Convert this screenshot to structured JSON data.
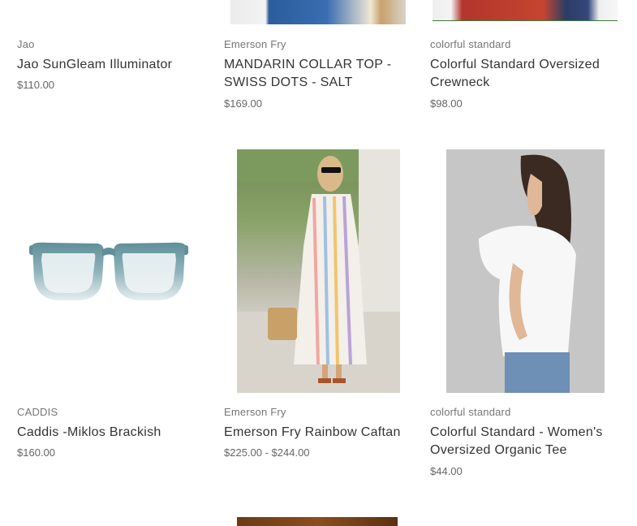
{
  "products": [
    {
      "brand": "Jao",
      "title": "Jao SunGleam Illuminator",
      "price": "$110.00"
    },
    {
      "brand": "Emerson Fry",
      "title_lines": [
        "MANDARIN COLLAR TOP -",
        "SWISS DOTS - SALT"
      ],
      "price": "$169.00"
    },
    {
      "brand": "colorful standard",
      "title_lines": [
        "Colorful Standard Oversized",
        "Crewneck"
      ],
      "price": "$98.00"
    },
    {
      "brand": "CADDIS",
      "title": "Caddis -Miklos Brackish",
      "price": "$160.00",
      "image_icon": "eyeglasses"
    },
    {
      "brand": "Emerson Fry",
      "title": "Emerson Fry Rainbow Caftan",
      "price": "$225.00 - $244.00",
      "image_icon": "caftan-dress-photo"
    },
    {
      "brand": "colorful standard",
      "title_lines": [
        "Colorful Standard - Women's",
        "Oversized Organic Tee"
      ],
      "price": "$44.00",
      "image_icon": "tee-shirt-photo"
    }
  ],
  "colors": {
    "brand_text": "#757575",
    "title_text": "#333333",
    "price_text": "#666666",
    "frame_teal": "#6f9aa3"
  }
}
